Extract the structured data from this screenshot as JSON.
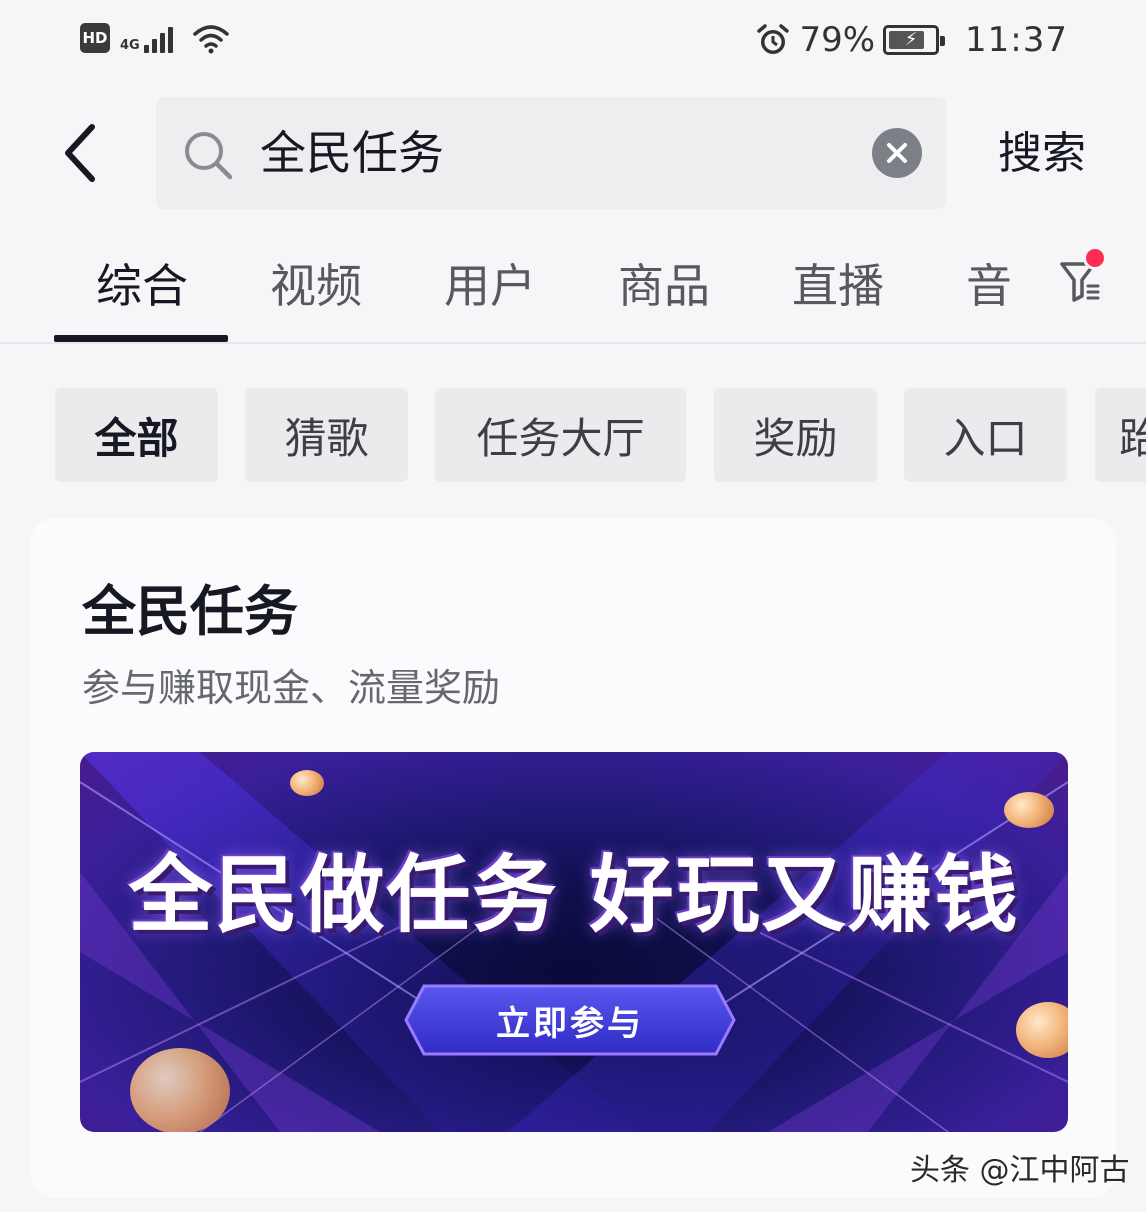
{
  "status_bar": {
    "hd_label": "HD",
    "network_label": "4G",
    "battery_percent": "79%",
    "battery_level": 0.79,
    "time": "11:37",
    "icons": [
      "hd-icon",
      "signal-icon",
      "wifi-icon",
      "alarm-icon",
      "battery-icon"
    ]
  },
  "search": {
    "query": "全民任务",
    "search_button": "搜索"
  },
  "tabs": [
    {
      "label": "综合",
      "active": true
    },
    {
      "label": "视频",
      "active": false
    },
    {
      "label": "用户",
      "active": false
    },
    {
      "label": "商品",
      "active": false
    },
    {
      "label": "直播",
      "active": false
    },
    {
      "label": "音",
      "active": false
    }
  ],
  "filter": {
    "icon": "filter-icon",
    "has_badge": true,
    "badge_color": "#fe2c55"
  },
  "chips": [
    {
      "label": "全部",
      "active": true
    },
    {
      "label": "猜歌",
      "active": false
    },
    {
      "label": "任务大厅",
      "active": false
    },
    {
      "label": "奖励",
      "active": false
    },
    {
      "label": "入口",
      "active": false
    },
    {
      "label": "跆",
      "active": false
    }
  ],
  "card": {
    "title": "全民任务",
    "subtitle": "参与赚取现金、流量奖励",
    "banner": {
      "headline": "全民做任务 好玩又赚钱",
      "cta": "立即参与"
    }
  },
  "watermark": "头条 @江中阿古",
  "colors": {
    "accent_red": "#fe2c55",
    "text_primary": "#161823",
    "banner_cta": "#3d3ad8"
  }
}
